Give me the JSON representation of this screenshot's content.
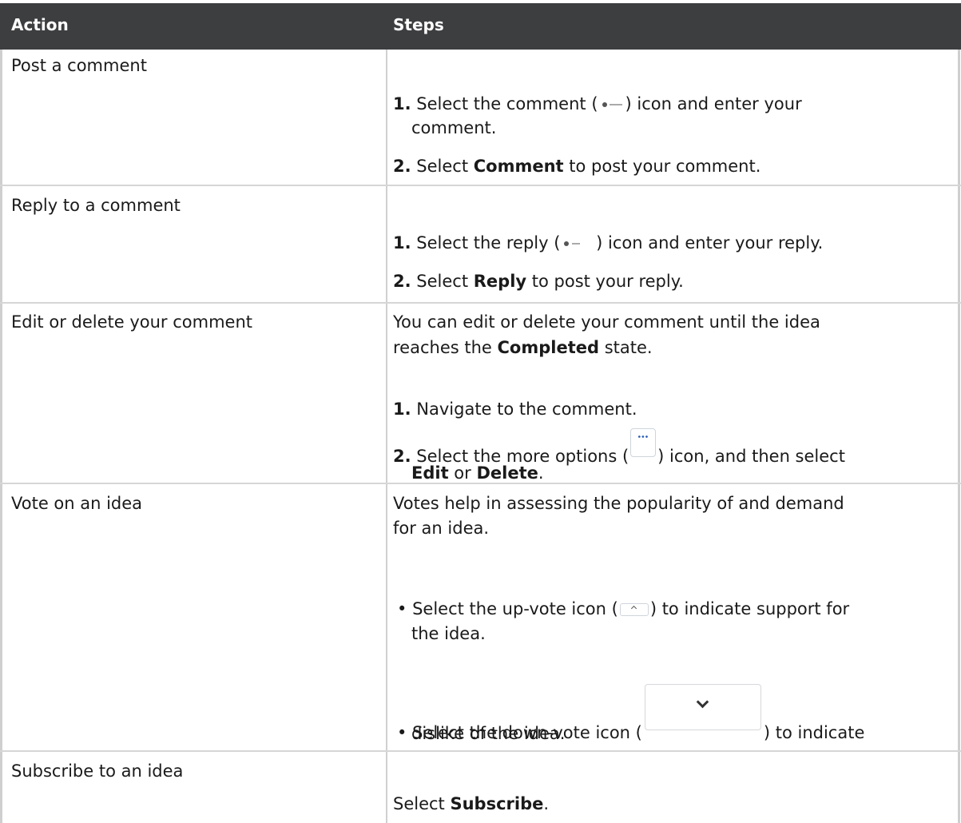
{
  "header": {
    "action": "Action",
    "steps": "Steps"
  },
  "rows": [
    {
      "action": "Post a comment",
      "steps": [
        {
          "num": "1.",
          "pre": "Select the comment (",
          "icon": "comment-icon",
          "post": ") icon and enter your",
          "cont": "comment."
        },
        {
          "num": "2.",
          "pre": "Select ",
          "bold": "Comment",
          "post": " to post your comment."
        }
      ]
    },
    {
      "action": "Reply to a comment",
      "steps": [
        {
          "num": "1.",
          "pre": "Select the reply (",
          "icon": "reply-icon",
          "post": " ) icon and enter your reply."
        },
        {
          "num": "2.",
          "pre": "Select ",
          "bold": "Reply",
          "post": " to post your reply."
        }
      ]
    },
    {
      "action": "Edit or delete your comment",
      "intro_a": "You can edit or delete your comment until the idea",
      "intro_b_pre": "reaches the ",
      "intro_b_bold": "Completed",
      "intro_b_post": " state.",
      "steps": [
        {
          "num": "1.",
          "text": "Navigate to the comment."
        },
        {
          "num": "2.",
          "pre": "Select the more options (",
          "icon": "more-options-icon",
          "post": ") icon, and then select",
          "cont_bold1": "Edit",
          "cont_mid": " or ",
          "cont_bold2": "Delete",
          "cont_end": "."
        }
      ]
    },
    {
      "action": "Vote on an idea",
      "intro_a": "Votes help in assessing the popularity of and demand",
      "intro_b": "for an idea.",
      "bullets": [
        {
          "pre": "Select the up-vote icon (",
          "icon": "up-vote-icon",
          "post": ") to indicate support for",
          "cont": "the idea."
        },
        {
          "pre": "Select the down-vote icon (",
          "icon": "down-vote-icon",
          "post": ") to indicate",
          "cont": "dislike of the idea."
        }
      ]
    },
    {
      "action": "Subscribe to an idea",
      "pre": "Select ",
      "bold": "Subscribe",
      "post": "."
    }
  ]
}
